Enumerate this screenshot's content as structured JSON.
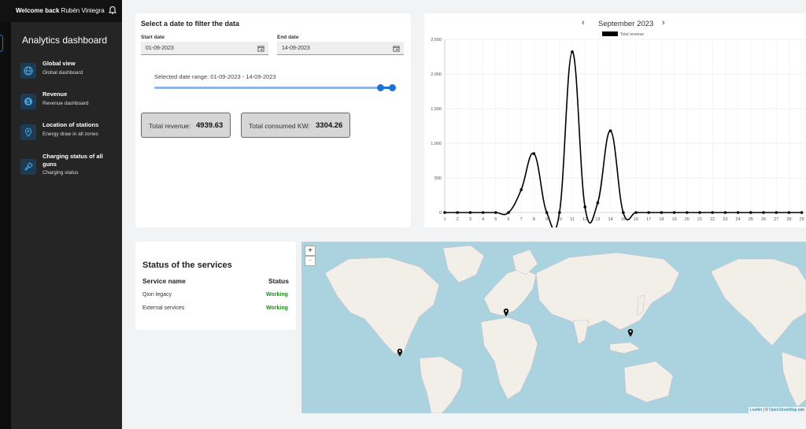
{
  "rail": {
    "label": "n"
  },
  "header": {
    "welcome_prefix": "Welcome back",
    "user_name": "Rubén Viniegra"
  },
  "sidebar": {
    "title": "Analytics dashboard",
    "items": [
      {
        "label": "Global view",
        "sub": "Global dashboard",
        "icon": "globe-icon"
      },
      {
        "label": "Revenue",
        "sub": "Revenue dashboard",
        "icon": "dollar-icon"
      },
      {
        "label": "Location of stations",
        "sub": "Energy draw in all zones",
        "icon": "location-pin-icon"
      },
      {
        "label": "Charging status of all guns",
        "sub": "Charging status",
        "icon": "charger-icon"
      }
    ]
  },
  "filter": {
    "title": "Select a date to filter the data",
    "start_label": "Start date",
    "start_value": "01-09-2023",
    "end_label": "End date",
    "end_value": "14-09-2023",
    "range_text": "Selected date range: 01-09-2023 - 14-09-2023",
    "revenue_label": "Total revenue:",
    "revenue_value": "4939.63",
    "kw_label": "Total consumed KW:",
    "kw_value": "3304.26"
  },
  "calendar": {
    "month": "September 2023",
    "prev": "‹",
    "next": "›"
  },
  "chart_data": {
    "type": "line",
    "series": [
      {
        "name": "Total revenue",
        "x": [
          1,
          2,
          3,
          4,
          5,
          6,
          7,
          8,
          9,
          10,
          11,
          12,
          13,
          14,
          15,
          16,
          17,
          18,
          19,
          20,
          21,
          22,
          23,
          24,
          25,
          26,
          27,
          28,
          29
        ],
        "values": [
          0,
          0,
          0,
          0,
          0,
          0,
          330,
          850,
          0,
          0,
          2320,
          80,
          140,
          1180,
          0,
          0,
          0,
          0,
          0,
          0,
          0,
          0,
          0,
          0,
          0,
          0,
          0,
          0,
          0
        ]
      }
    ],
    "ylim": [
      0,
      2500
    ],
    "yticks": [
      0,
      500,
      1000,
      1500,
      2000,
      2500
    ],
    "ytick_labels": [
      "0",
      "500",
      "1,000",
      "1,500",
      "2,000",
      "2,500"
    ],
    "xtick_labels": [
      "1",
      "2",
      "3",
      "4",
      "5",
      "6",
      "7",
      "8",
      "9",
      "10",
      "11",
      "12",
      "13",
      "14",
      "15",
      "16",
      "17",
      "18",
      "19",
      "20",
      "21",
      "22",
      "23",
      "24",
      "25",
      "26",
      "27",
      "28",
      "29"
    ],
    "grid": true,
    "legend": "top"
  },
  "status": {
    "title": "Status of the services",
    "col_name": "Service name",
    "col_status": "Status",
    "rows": [
      {
        "name": "Qion legacy",
        "status": "Working"
      },
      {
        "name": "External services",
        "status": "Working"
      }
    ]
  },
  "map": {
    "zoom_in": "+",
    "zoom_out": "−",
    "attribution_link": "Leaflet",
    "attribution_sep": " | © ",
    "attribution_link2": "OpenStreetMap",
    "attribution_tail": " con"
  },
  "colors": {
    "sidebar_bg": "#252525",
    "accent": "#1e6fd6",
    "ok_green": "#1e8a1e"
  }
}
